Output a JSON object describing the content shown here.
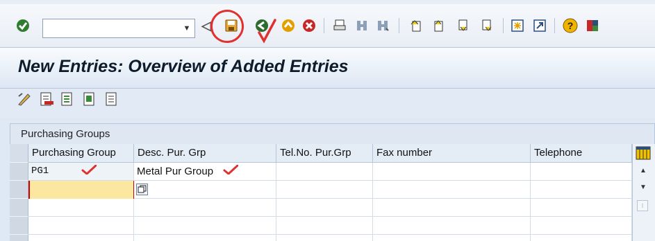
{
  "toolbar": {
    "command_value": "",
    "icons": [
      "enter-icon",
      "command-dropdown-icon",
      "back-arrow-icon",
      "save-icon",
      "back-icon",
      "exit-icon",
      "cancel-icon",
      "print-icon",
      "find-icon",
      "find-next-icon",
      "first-page-icon",
      "previous-page-icon",
      "next-page-icon",
      "last-page-icon",
      "new-session-icon",
      "shortcut-icon",
      "help-icon",
      "customize-layout-icon"
    ]
  },
  "title": "New Entries: Overview of Added Entries",
  "app_toolbar": {
    "icons": [
      "change-display-icon",
      "delete-entry-icon",
      "select-all-icon",
      "select-block-icon",
      "deselect-all-icon"
    ]
  },
  "table": {
    "title": "Purchasing Groups",
    "columns": [
      "Purchasing Group",
      "Desc. Pur. Grp",
      "Tel.No. Pur.Grp",
      "Fax number",
      "Telephone"
    ],
    "rows": [
      [
        "PG1",
        "Metal Pur Group",
        "",
        "",
        ""
      ],
      [
        "",
        "",
        "",
        "",
        ""
      ],
      [
        "",
        "",
        "",
        "",
        ""
      ],
      [
        "",
        "",
        "",
        "",
        ""
      ],
      [
        "",
        "",
        "",
        "",
        ""
      ]
    ]
  },
  "colors": {
    "annotation": "#e03131",
    "active_cell": "#fbe7a0",
    "title_text": "#0d1b2a"
  }
}
